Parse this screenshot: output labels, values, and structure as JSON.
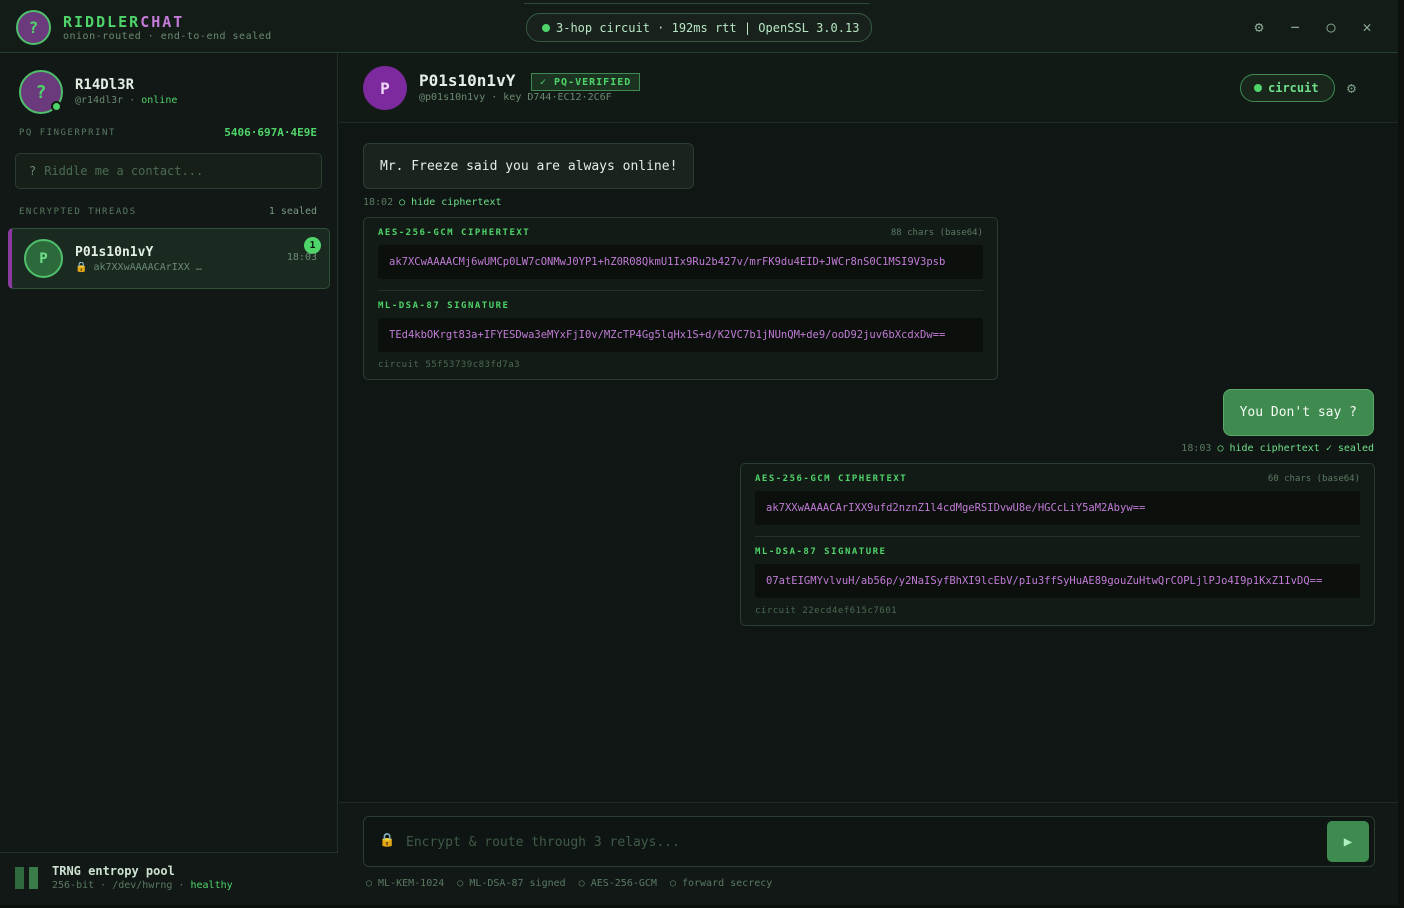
{
  "app": {
    "name_a": "RIDDLER",
    "name_b": "CHAT",
    "subtitle": "onion-routed · end-to-end sealed",
    "logo_glyph": "?",
    "circuit_status": "3-hop circuit · 192ms rtt | OpenSSL 3.0.13",
    "controls": {
      "settings": "⚙",
      "minimize": "−",
      "maximize": "○",
      "close": "✕"
    }
  },
  "me": {
    "avatar_glyph": "?",
    "name": "R14Dl3R",
    "handle": "@r14dl3r",
    "sep": " · ",
    "status": "online",
    "fingerprint_label": "PQ FINGERPRINT",
    "fingerprint": "5406·697A·4E9E"
  },
  "search": {
    "icon": "?",
    "placeholder": "Riddle me a contact..."
  },
  "threads": {
    "label": "ENCRYPTED THREADS",
    "count": "1 sealed",
    "items": [
      {
        "avatar": "P",
        "name": "P01s10n1vY",
        "preview": "🔒 ak7XXwAAAACArIXX …",
        "time": "18:03",
        "unread": "1"
      }
    ]
  },
  "entropy": {
    "title": "TRNG entropy pool",
    "sub": "256-bit · /dev/hwrng · ",
    "status": "healthy"
  },
  "contact": {
    "avatar": "P",
    "name": "P01s10n1vY",
    "badge": "✓ PQ-VERIFIED",
    "sub": "@p01s10n1vy · key D744·EC12·2C6F",
    "circuit_btn": "circuit",
    "gear": "⚙"
  },
  "messages": [
    {
      "direction": "in",
      "text": "Mr. Freeze said you are always online!",
      "time": "18:02",
      "toggle": "○ hide ciphertext",
      "sealed": "",
      "cipher_label": "AES-256-GCM CIPHERTEXT",
      "cipher_count": "88 chars (base64)",
      "ciphertext": "ak7XCwAAAACMj6wUMCp0LW7cONMwJ0YP1+hZ0R08QkmU1Ix9Ru2b427v/mrFK9du4EID+JWCr8nS0C1MSI9V3psb",
      "sig_label": "ML-DSA-87 SIGNATURE",
      "signature": "TEd4kbOKrgt83a+IFYESDwa3eMYxFjI0v/MZcTP4Gg5lqHx1S+d/K2VC7b1jNUnQM+de9/ooD92juv6bXcdxDw==",
      "circuit": "circuit 55f53739c83fd7a3"
    },
    {
      "direction": "out",
      "text": "You Don't say ?",
      "time": "18:03",
      "toggle": "○ hide ciphertext",
      "sealed": "✓ sealed",
      "cipher_label": "AES-256-GCM CIPHERTEXT",
      "cipher_count": "60 chars (base64)",
      "ciphertext": "ak7XXwAAAACArIXX9ufd2nznZ1l4cdMgeRSIDvwU8e/HGCcLiY5aM2Abyw==",
      "sig_label": "ML-DSA-87 SIGNATURE",
      "signature": "07atEIGMYvlvuH/ab56p/y2NaISyfBhXI9lcEbV/pIu3ffSyHuAE89gouZuHtwQrCOPLjlPJo4I9p1KxZ1IvDQ==",
      "circuit": "circuit 22ecd4ef615c7601"
    }
  ],
  "composer": {
    "lock_icon": "🔒",
    "placeholder": "Encrypt & route through 3 relays...",
    "send_icon": "▶",
    "features": [
      "○ ML-KEM-1024",
      "○ ML-DSA-87 signed",
      "○ AES-256-GCM",
      "○ forward secrecy"
    ]
  },
  "colors": {
    "accent": "#4fd46a",
    "purple": "#c27bd6",
    "bg": "#111714"
  }
}
